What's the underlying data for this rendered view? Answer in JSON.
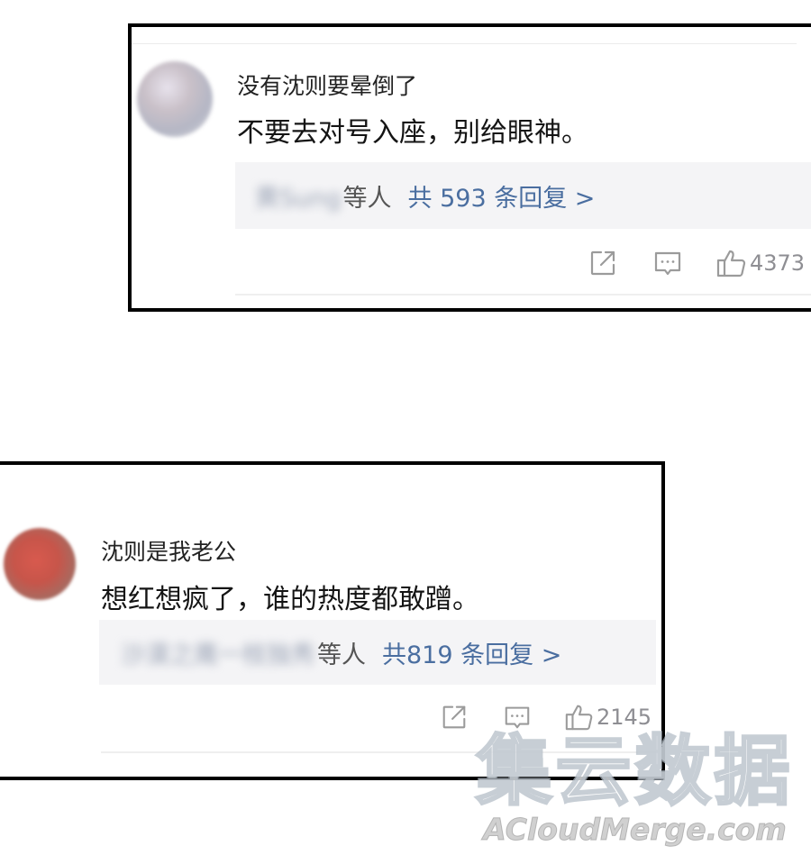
{
  "comments": [
    {
      "username": "没有沈则要晕倒了",
      "text": "不要去对号入座，别给眼神。",
      "reply_names": "黄Sung",
      "reply_suffix": "等人",
      "reply_count_label": "共 593 条回复 >",
      "like_count": "4373"
    },
    {
      "username": "沈则是我老公",
      "text": "想红想疯了，谁的热度都敢蹭。",
      "reply_names": "沙漠之鹰一枝独秀",
      "reply_suffix": "等人",
      "reply_count_label": "共819 条回复 >",
      "like_count": "2145"
    }
  ],
  "icons": {
    "share": "share-icon",
    "comment": "comment-icon",
    "like": "thumbs-up-icon"
  },
  "colors": {
    "frame_border": "#000000",
    "reply_link": "#4a6ea0",
    "reply_box_bg": "#f4f4f6",
    "icon_gray": "#9b9b9b"
  },
  "watermark": {
    "chinese": "集云数据",
    "english": "ACloudMerge.com"
  }
}
